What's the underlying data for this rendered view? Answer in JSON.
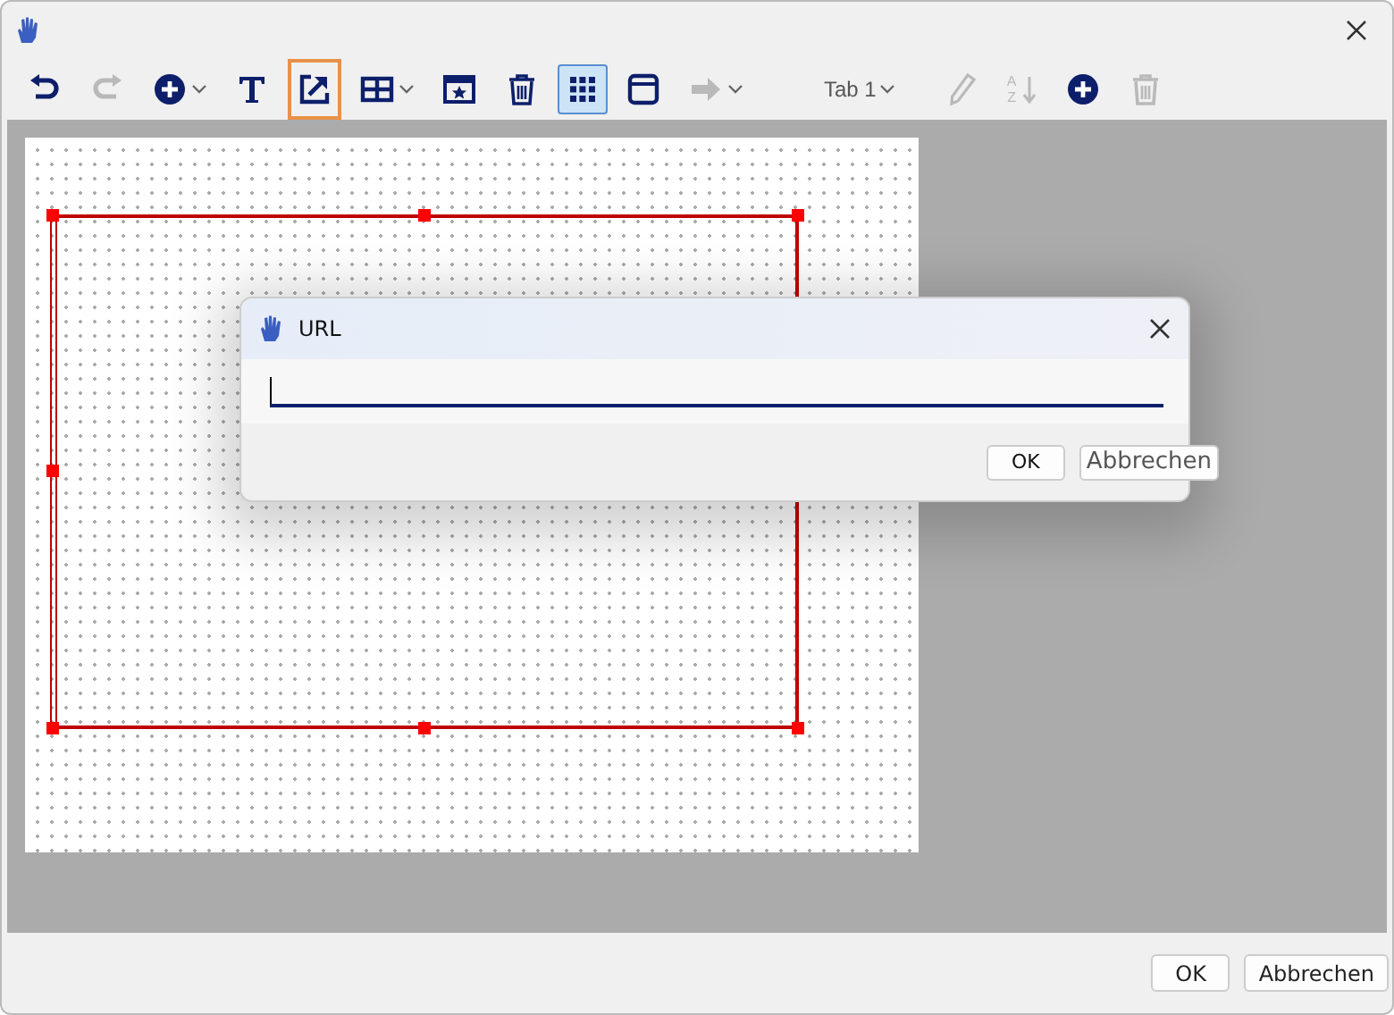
{
  "toolbar": [
    {
      "kind": "undo",
      "disabled": false,
      "selected": false,
      "focused": false,
      "dropdown": false
    },
    {
      "kind": "redo",
      "disabled": true,
      "selected": false,
      "focused": false,
      "dropdown": false
    },
    {
      "kind": "add",
      "disabled": false,
      "selected": false,
      "focused": false,
      "dropdown": true
    },
    {
      "kind": "text",
      "disabled": false,
      "selected": false,
      "focused": false,
      "dropdown": false
    },
    {
      "kind": "export",
      "disabled": false,
      "selected": false,
      "focused": true,
      "dropdown": false
    },
    {
      "kind": "table",
      "disabled": false,
      "selected": false,
      "focused": false,
      "dropdown": true
    },
    {
      "kind": "star-window",
      "disabled": false,
      "selected": false,
      "focused": false,
      "dropdown": false
    },
    {
      "kind": "trash",
      "disabled": false,
      "selected": false,
      "focused": false,
      "dropdown": false
    },
    {
      "kind": "grid",
      "disabled": false,
      "selected": true,
      "focused": false,
      "dropdown": false
    },
    {
      "kind": "window",
      "disabled": false,
      "selected": false,
      "focused": false,
      "dropdown": false
    },
    {
      "kind": "arrow",
      "disabled": true,
      "selected": false,
      "focused": false,
      "dropdown": true
    },
    {
      "kind": "tab-select",
      "label": "Tab 1",
      "disabled": false,
      "selected": false,
      "focused": false,
      "dropdown": true
    },
    {
      "kind": "pencil",
      "disabled": true,
      "selected": false,
      "focused": false,
      "dropdown": false
    },
    {
      "kind": "sort",
      "letters": [
        "A",
        "Z"
      ],
      "disabled": true,
      "selected": false,
      "focused": false,
      "dropdown": false
    },
    {
      "kind": "add",
      "disabled": false,
      "selected": false,
      "focused": false,
      "dropdown": false
    },
    {
      "kind": "trash",
      "disabled": true,
      "selected": false,
      "focused": false,
      "dropdown": false
    }
  ],
  "dialog": {
    "title": "URL",
    "buttons": [
      {
        "label": "OK"
      },
      {
        "label": "Abbrechen"
      }
    ]
  },
  "buttons": [
    {
      "label": "OK"
    },
    {
      "label": "Abbrechen"
    }
  ]
}
